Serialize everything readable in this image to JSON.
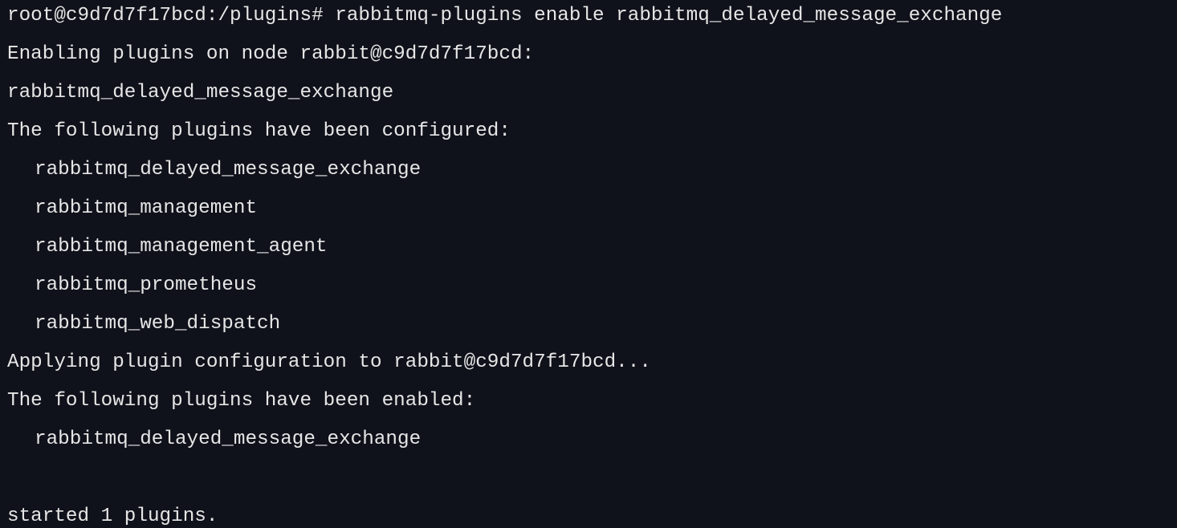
{
  "terminal": {
    "lines": [
      {
        "text": "root@c9d7d7f17bcd:/plugins# rabbitmq-plugins enable rabbitmq_delayed_message_exchange"
      },
      {
        "text": "Enabling plugins on node rabbit@c9d7d7f17bcd:"
      },
      {
        "text": "rabbitmq_delayed_message_exchange"
      },
      {
        "text": "The following plugins have been configured:"
      },
      {
        "text": "rabbitmq_delayed_message_exchange"
      },
      {
        "text": "rabbitmq_management"
      },
      {
        "text": "rabbitmq_management_agent"
      },
      {
        "text": "rabbitmq_prometheus"
      },
      {
        "text": "rabbitmq_web_dispatch"
      },
      {
        "text": "Applying plugin configuration to rabbit@c9d7d7f17bcd..."
      },
      {
        "text": "The following plugins have been enabled:"
      },
      {
        "text": "rabbitmq_delayed_message_exchange"
      },
      {
        "text": ""
      },
      {
        "text": "started 1 plugins."
      }
    ]
  },
  "colors": {
    "background": "#0f121b",
    "foreground": "#e6e6e6"
  }
}
